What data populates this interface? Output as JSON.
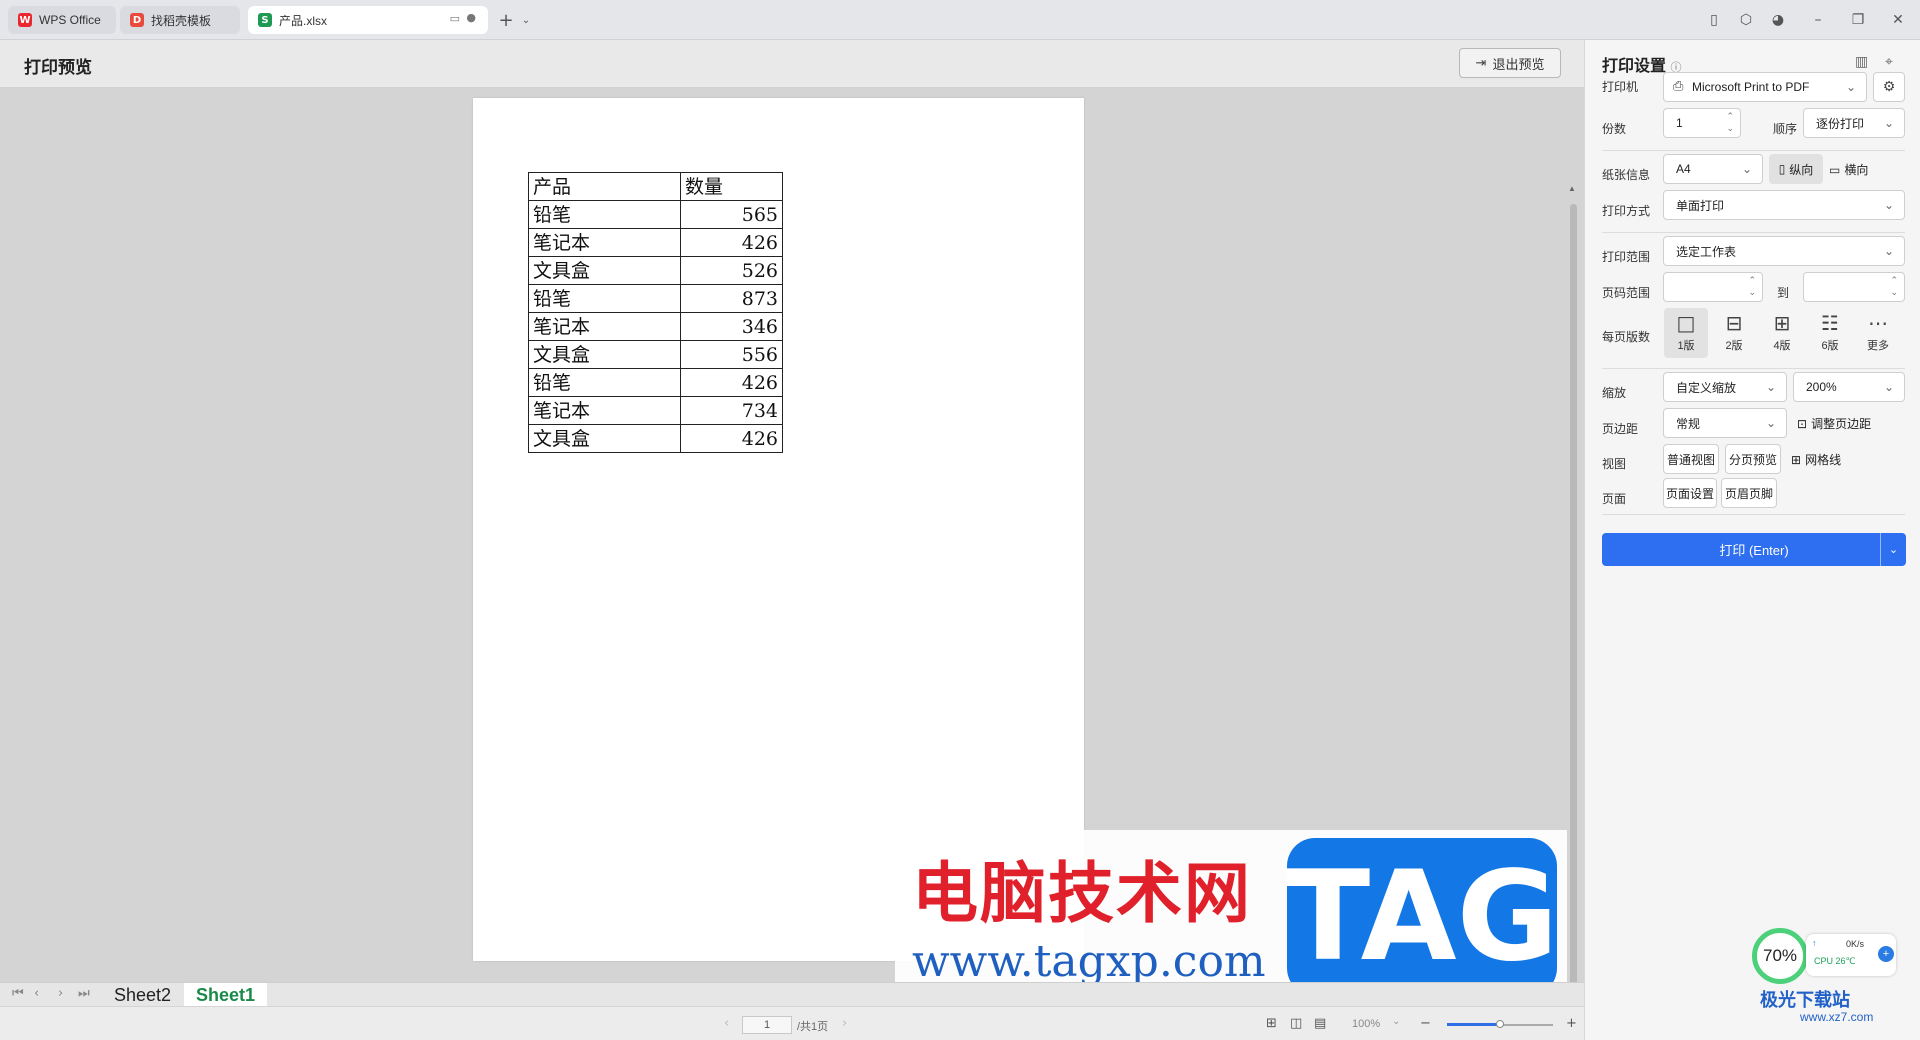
{
  "tabs": [
    {
      "label": "WPS Office",
      "icon": "wps-logo-icon",
      "active": false
    },
    {
      "label": "找稻壳模板",
      "icon": "docer-icon",
      "active": false
    },
    {
      "label": "产品.xlsx",
      "icon": "spreadsheet-icon",
      "active": true
    }
  ],
  "header": {
    "title": "打印预览",
    "exit_label": "退出预览"
  },
  "sheet": {
    "columns": [
      "产品",
      "数量"
    ],
    "rows": [
      {
        "product": "铅笔",
        "qty": "565"
      },
      {
        "product": "笔记本",
        "qty": "426"
      },
      {
        "product": "文具盒",
        "qty": "526"
      },
      {
        "product": "铅笔",
        "qty": "873"
      },
      {
        "product": "笔记本",
        "qty": "346"
      },
      {
        "product": "文具盒",
        "qty": "556"
      },
      {
        "product": "铅笔",
        "qty": "426"
      },
      {
        "product": "笔记本",
        "qty": "734"
      },
      {
        "product": "文具盒",
        "qty": "426"
      }
    ]
  },
  "sheet_tabs": [
    "Sheet2",
    "Sheet1"
  ],
  "status": {
    "page_value": "1",
    "page_total": "/共1页",
    "zoom": "100%"
  },
  "panel": {
    "title": "打印设置",
    "printer_label": "打印机",
    "printer_value": "Microsoft Print to PDF",
    "copies_label": "份数",
    "copies_value": "1",
    "order_label": "顺序",
    "order_value": "逐份打印",
    "paper_label": "纸张信息",
    "paper_value": "A4",
    "portrait_label": "纵向",
    "landscape_label": "横向",
    "mode_label": "打印方式",
    "mode_value": "单面打印",
    "range_label": "打印范围",
    "range_value": "选定工作表",
    "pages_label": "页码范围",
    "pages_to": "到",
    "layout_label": "每页版数",
    "layouts": [
      "1版",
      "2版",
      "4版",
      "6版",
      "更多"
    ],
    "scale_label": "缩放",
    "scale_value": "自定义缩放",
    "scale_pct": "200%",
    "margin_label": "页边距",
    "margin_value": "常规",
    "margin_adjust": "调整页边距",
    "view_label": "视图",
    "view_normal": "普通视图",
    "view_pagebreak": "分页预览",
    "view_grid": "网格线",
    "page_label": "页面",
    "page_setup": "页面设置",
    "header_footer": "页眉页脚",
    "print_button": "打印 (Enter)"
  },
  "watermark": {
    "cn": "电脑技术网",
    "url": "www.tagxp.com",
    "tag": "TAG"
  },
  "perf": {
    "percent": "70%",
    "net": "0K/s",
    "cpu": "CPU 26℃"
  },
  "corner_logo": {
    "name": "极光下载站",
    "url": "www.xz7.com"
  }
}
